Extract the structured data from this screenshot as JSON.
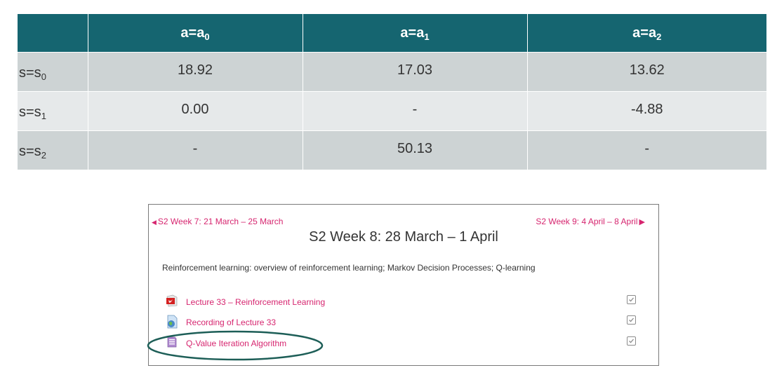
{
  "qtable": {
    "header": {
      "corner": "",
      "cols": [
        {
          "base": "a=a",
          "sub": "0"
        },
        {
          "base": "a=a",
          "sub": "1"
        },
        {
          "base": "a=a",
          "sub": "2"
        }
      ]
    },
    "rows": [
      {
        "base": "s=s",
        "sub": "0",
        "values": [
          "18.92",
          "17.03",
          "13.62"
        ]
      },
      {
        "base": "s=s",
        "sub": "1",
        "values": [
          "0.00",
          "-",
          "-4.88"
        ]
      },
      {
        "base": "s=s",
        "sub": "2",
        "values": [
          "-",
          "50.13",
          "-"
        ]
      }
    ],
    "colors": {
      "header_bg": "#156570",
      "row_dark": "#cdd3d4",
      "row_light": "#e6e9ea"
    }
  },
  "course": {
    "prev_link": "S2 Week 7: 21 March – 25 March",
    "next_link": "S2 Week 9: 4 April – 8 April",
    "section_title": "S2 Week 8: 28 March – 1 April",
    "summary": "Reinforcement learning: overview of reinforcement learning; Markov Decision Processes; Q-learning",
    "activities": [
      {
        "label": "Lecture 33 – Reinforcement Learning",
        "icon": "pdf-icon"
      },
      {
        "label": "Recording of Lecture 33",
        "icon": "url-icon"
      },
      {
        "label": "Q-Value Iteration Algorithm",
        "icon": "page-icon"
      }
    ],
    "link_color": "#d6256f",
    "highlight_color": "#1d5e57"
  }
}
